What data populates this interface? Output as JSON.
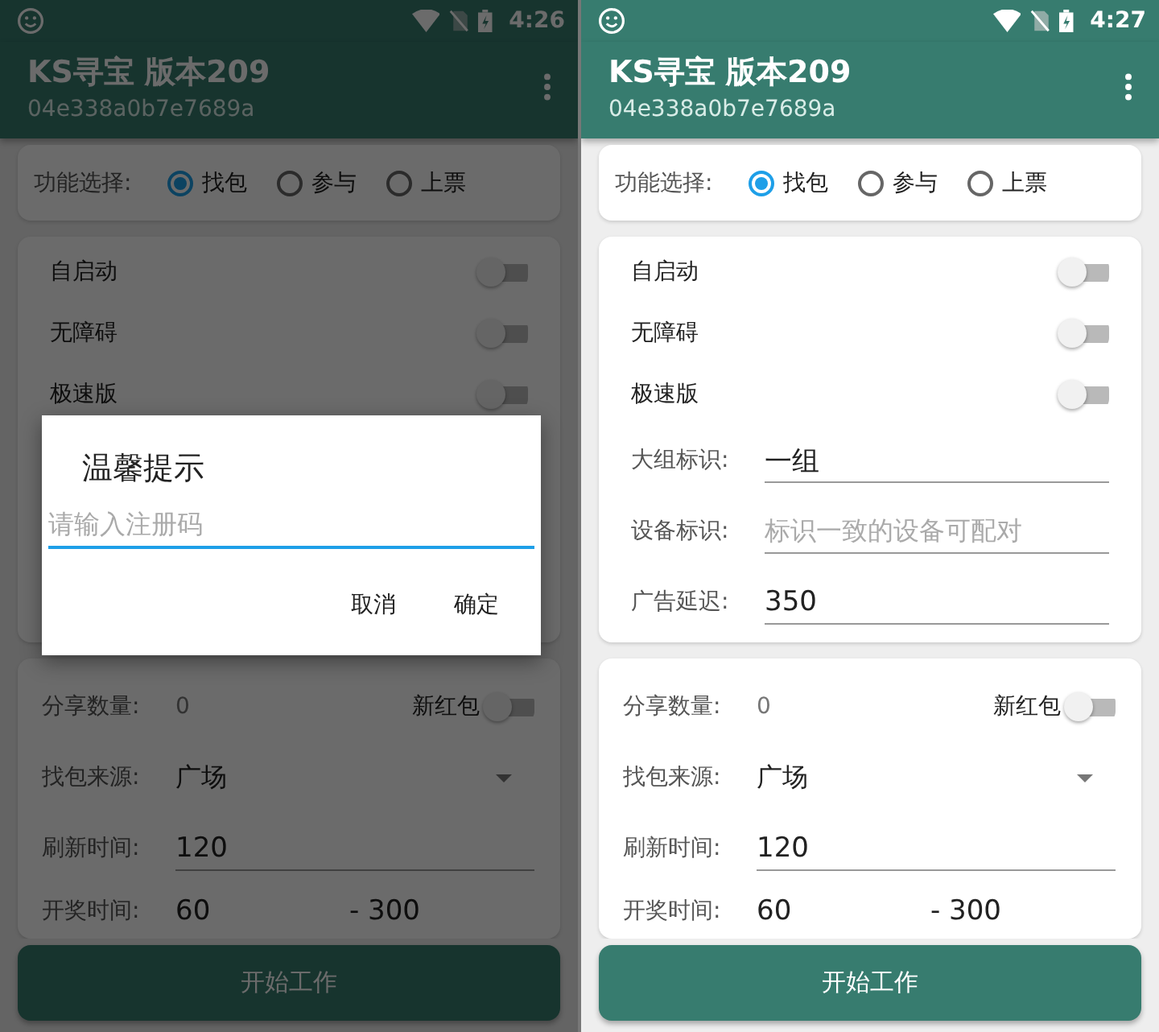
{
  "phones": [
    {
      "status_bar": {
        "time": "4:26"
      },
      "app_bar": {
        "title": "KS寻宝 版本209",
        "subtitle": "04e338a0b7e7689a"
      },
      "function_select": {
        "label": "功能选择:",
        "options": [
          {
            "label": "找包",
            "selected": true
          },
          {
            "label": "参与",
            "selected": false
          },
          {
            "label": "上票",
            "selected": false
          }
        ]
      },
      "toggles": [
        {
          "label": "自启动",
          "on": false
        },
        {
          "label": "无障碍",
          "on": false
        },
        {
          "label": "极速版",
          "on": false
        }
      ],
      "share": {
        "label": "分享数量:",
        "value": "0"
      },
      "new_redpacket": {
        "label": "新红包",
        "on": false
      },
      "source": {
        "label": "找包来源:",
        "value": "广场"
      },
      "refresh": {
        "label": "刷新时间:",
        "value": "120"
      },
      "draw_time": {
        "label": "开奖时间:",
        "from": "60",
        "to": "- 300"
      },
      "start_button": "开始工作",
      "dialog": {
        "title": "温馨提示",
        "placeholder": "请输入注册码",
        "buttons": [
          "取消",
          "确定"
        ]
      }
    },
    {
      "status_bar": {
        "time": "4:27"
      },
      "app_bar": {
        "title": "KS寻宝 版本209",
        "subtitle": "04e338a0b7e7689a"
      },
      "function_select": {
        "label": "功能选择:",
        "options": [
          {
            "label": "找包",
            "selected": true
          },
          {
            "label": "参与",
            "selected": false
          },
          {
            "label": "上票",
            "selected": false
          }
        ]
      },
      "toggles": [
        {
          "label": "自启动",
          "on": false
        },
        {
          "label": "无障碍",
          "on": false
        },
        {
          "label": "极速版",
          "on": false
        }
      ],
      "fields": [
        {
          "label": "大组标识:",
          "value": "一组"
        },
        {
          "label": "设备标识:",
          "placeholder": "标识一致的设备可配对"
        },
        {
          "label": "广告延迟:",
          "value": "350"
        }
      ],
      "share": {
        "label": "分享数量:",
        "value": "0"
      },
      "new_redpacket": {
        "label": "新红包",
        "on": false
      },
      "source": {
        "label": "找包来源:",
        "value": "广场"
      },
      "refresh": {
        "label": "刷新时间:",
        "value": "120"
      },
      "draw_time": {
        "label": "开奖时间:",
        "from": "60",
        "to": "- 300"
      },
      "start_button": "开始工作"
    }
  ]
}
